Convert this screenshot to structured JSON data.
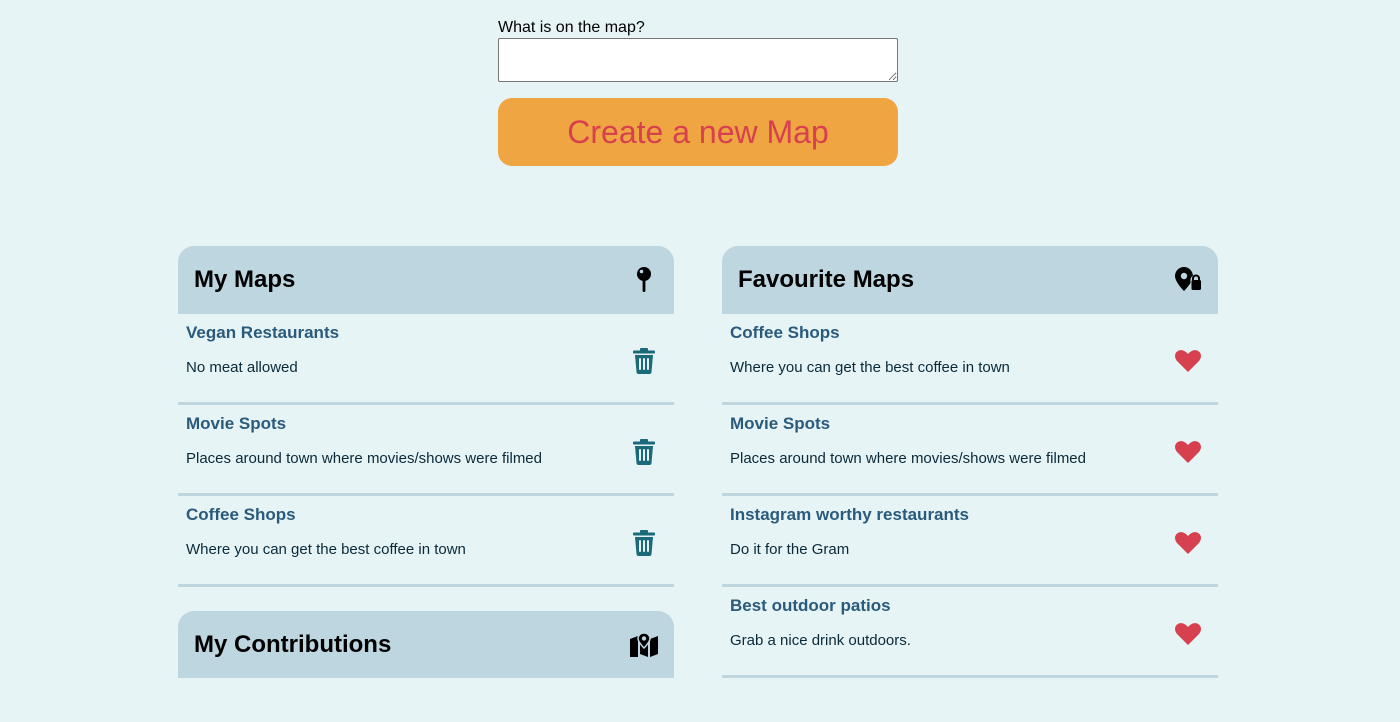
{
  "form": {
    "label": "What is on the map?",
    "textarea_value": "",
    "create_button": "Create a new Map"
  },
  "colors": {
    "background": "#e6f4f5",
    "panel_header": "#bdd6df",
    "create_button_bg": "#efa542",
    "create_button_text": "#d6404f",
    "map_name": "#2a5a7c",
    "trash_icon": "#1a6a7a",
    "heart_icon": "#d6404f"
  },
  "my_maps": {
    "title": "My Maps",
    "icon": "pushpin-icon",
    "items": [
      {
        "name": "Vegan Restaurants",
        "description": "No meat allowed",
        "action_icon": "trash-icon"
      },
      {
        "name": "Movie Spots",
        "description": "Places around town where movies/shows were filmed",
        "action_icon": "trash-icon"
      },
      {
        "name": "Coffee Shops",
        "description": "Where you can get the best coffee in town",
        "action_icon": "trash-icon"
      }
    ]
  },
  "my_contributions": {
    "title": "My Contributions",
    "icon": "folded-map-icon"
  },
  "favourite_maps": {
    "title": "Favourite Maps",
    "icon": "location-lock-icon",
    "items": [
      {
        "name": "Coffee Shops",
        "description": "Where you can get the best coffee in town",
        "action_icon": "heart-icon"
      },
      {
        "name": "Movie Spots",
        "description": "Places around town where movies/shows were filmed",
        "action_icon": "heart-icon"
      },
      {
        "name": "Instagram worthy restaurants",
        "description": "Do it for the Gram",
        "action_icon": "heart-icon"
      },
      {
        "name": "Best outdoor patios",
        "description": "Grab a nice drink outdoors.",
        "action_icon": "heart-icon"
      }
    ]
  }
}
